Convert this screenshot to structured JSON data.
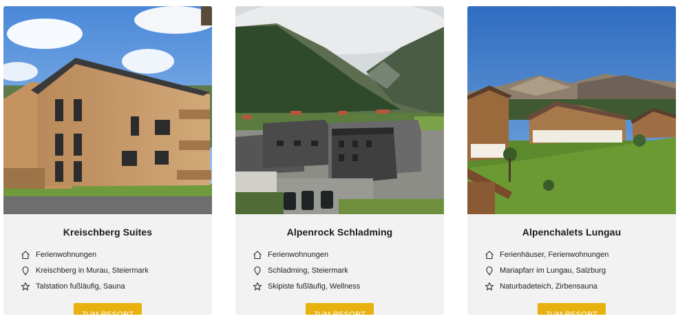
{
  "cards": [
    {
      "title": "Kreischberg Suites",
      "features": [
        {
          "icon": "house-icon",
          "text": "Ferienwohnungen"
        },
        {
          "icon": "location-pin-icon",
          "text": "Kreischberg in Murau, Steiermark"
        },
        {
          "icon": "star-icon",
          "text": "Talstation fußläufig, Sauna"
        }
      ],
      "button_label": "ZUM RESORT"
    },
    {
      "title": "Alpenrock Schladming",
      "features": [
        {
          "icon": "house-icon",
          "text": "Ferienwohnungen"
        },
        {
          "icon": "location-pin-icon",
          "text": "Schladming, Steiermark"
        },
        {
          "icon": "star-icon",
          "text": "Skipiste fußläufig, Wellness"
        }
      ],
      "button_label": "ZUM RESORT"
    },
    {
      "title": "Alpenchalets Lungau",
      "features": [
        {
          "icon": "house-icon",
          "text": "Ferienhäuser, Ferienwohnungen"
        },
        {
          "icon": "location-pin-icon",
          "text": "Mariapfarr im Lungau, Salzburg"
        },
        {
          "icon": "star-icon",
          "text": "Naturbadeteich, Zirbensauna"
        }
      ],
      "button_label": "ZUM RESORT"
    }
  ],
  "colors": {
    "card_background": "#f2f2f2",
    "button_background": "#e8b10f",
    "button_text": "#ffffff",
    "title_text": "#1a1a1a"
  }
}
